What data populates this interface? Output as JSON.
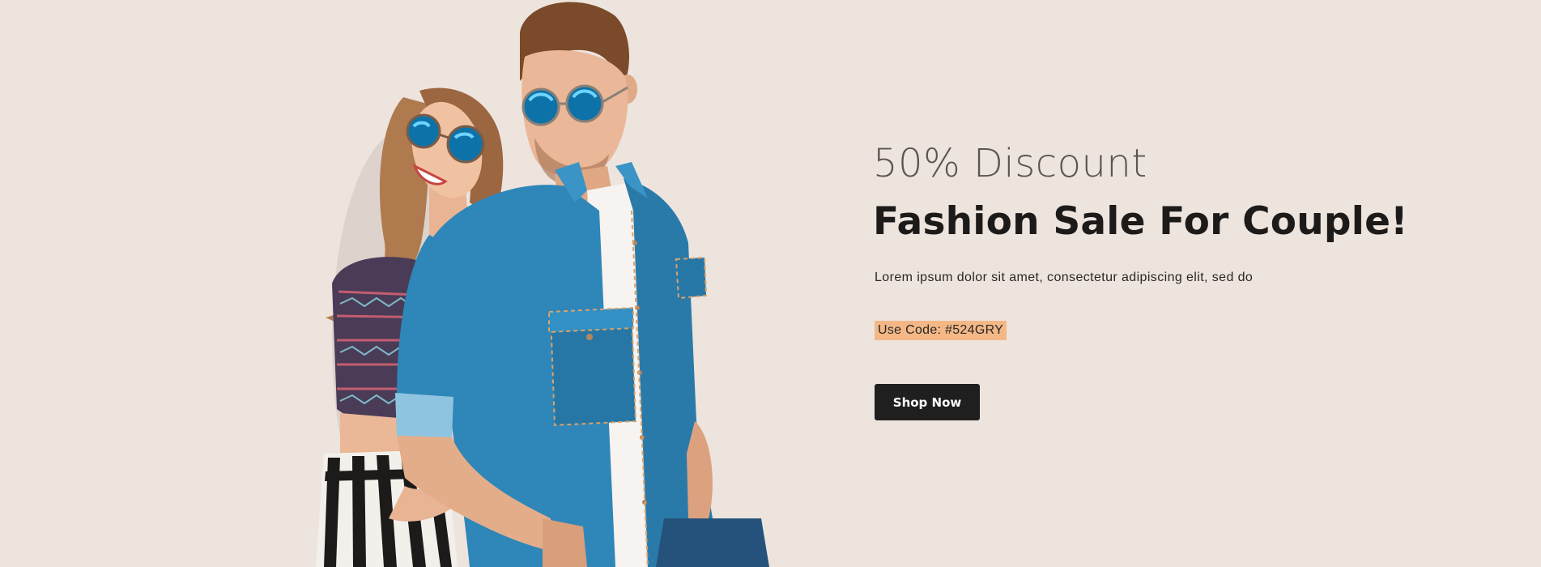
{
  "banner": {
    "eyebrow": "50% Discount",
    "headline": "Fashion Sale For Couple!",
    "description": "Lorem ipsum dolor sit amet, consectetur adipiscing elit, sed do",
    "code_label": "Use Code: #524GRY",
    "cta_label": "Shop Now",
    "colors": {
      "background": "#ede4de",
      "accent_badge": "#f4b887",
      "button": "#1f1f1f",
      "denim": "#2f86b8"
    },
    "image": {
      "alt_semantic": "couple-in-sunglasses-photo"
    }
  }
}
